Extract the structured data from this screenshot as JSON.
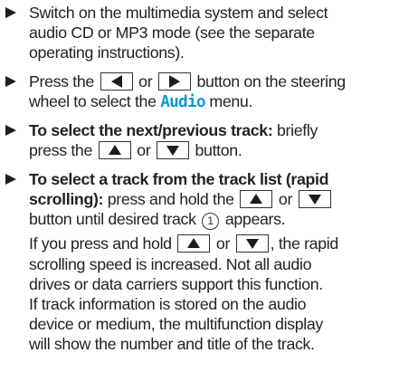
{
  "instructions": {
    "step1": {
      "line1": "Switch on the multimedia system and select",
      "line2": "audio CD or MP3 mode (see the separate",
      "line3": "operating instructions)."
    },
    "step2": {
      "pre": "Press the",
      "mid": "or",
      "post": "button on the steering",
      "line2_pre": "wheel to select the",
      "menu": "Audio",
      "line2_post": "menu."
    },
    "step3": {
      "bold": "To select the next/previous track:",
      "post": "briefly",
      "line2_pre": "press the",
      "mid": "or",
      "line2_post": "button."
    },
    "step4": {
      "bold1": "To select a track from the track list (rapid",
      "bold2": "scrolling):",
      "line2_post": "press and hold the",
      "mid": "or",
      "line3_pre": "button until desired track",
      "callout": "1",
      "line3_post": "appears.",
      "p2_pre": "If you press and hold",
      "p2_mid": "or",
      "p2_post": ", the rapid",
      "p3": "scrolling speed is increased. Not all audio",
      "p4": "drives or data carriers support this function.",
      "p5": "If track information is stored on the audio",
      "p6": "device or medium, the multifunction display",
      "p7": "will show the number and title of the track."
    }
  }
}
